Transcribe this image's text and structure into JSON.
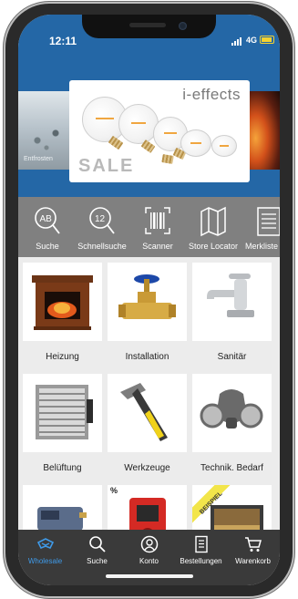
{
  "status_bar": {
    "time": "12:11",
    "network": "4G"
  },
  "banner": {
    "brand": "i-effects",
    "sale_text": "SALE",
    "left_caption": "Entfrosten"
  },
  "shortcuts": [
    {
      "label": "Suche",
      "icon": "ab-search-icon"
    },
    {
      "label": "Schnellsuche",
      "icon": "quick-search-icon"
    },
    {
      "label": "Scanner",
      "icon": "barcode-scanner-icon"
    },
    {
      "label": "Store Locator",
      "icon": "map-icon"
    },
    {
      "label": "Merkliste",
      "icon": "list-icon"
    }
  ],
  "categories": [
    {
      "label": "Heizung",
      "badge": ""
    },
    {
      "label": "Installation",
      "badge": ""
    },
    {
      "label": "Sanitär",
      "badge": ""
    },
    {
      "label": "Belüftung",
      "badge": ""
    },
    {
      "label": "Werkzeuge",
      "badge": ""
    },
    {
      "label": "Technik. Bedarf",
      "badge": ""
    },
    {
      "label": "",
      "badge": ""
    },
    {
      "label": "",
      "badge": "%"
    },
    {
      "label": "",
      "badge": "BEISPIEL"
    }
  ],
  "row3_extra_badge": "%",
  "tabbar": [
    {
      "label": "Wholesale",
      "icon": "wholesale-icon",
      "active": true
    },
    {
      "label": "Suche",
      "icon": "search-icon",
      "active": false
    },
    {
      "label": "Konto",
      "icon": "account-icon",
      "active": false
    },
    {
      "label": "Bestellungen",
      "icon": "orders-icon",
      "active": false
    },
    {
      "label": "Warenkorb",
      "icon": "cart-icon",
      "active": false
    }
  ],
  "colors": {
    "header_blue": "#2467a6",
    "shortcut_gray": "#808080",
    "tabbar_dark": "#3a3a3a",
    "active_blue": "#3f9ae8"
  }
}
